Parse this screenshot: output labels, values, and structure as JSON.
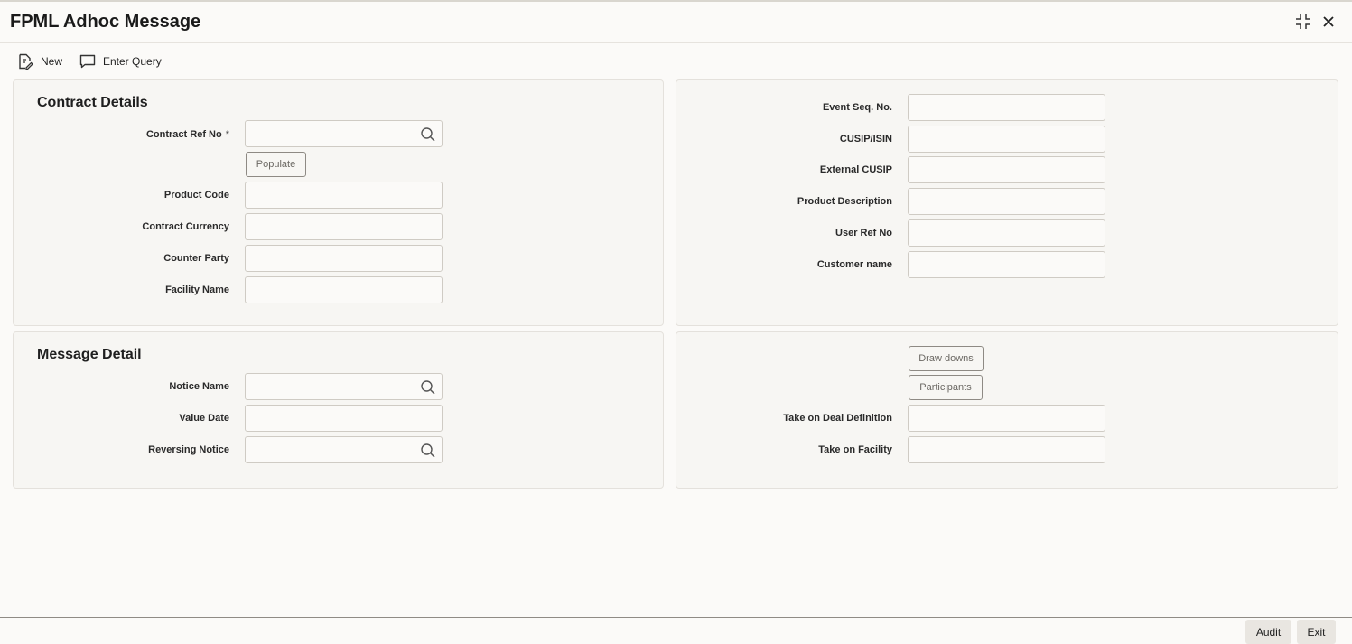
{
  "window": {
    "title": "FPML Adhoc Message",
    "controls": {
      "minimize_icon": "collapse-arrows-icon",
      "close_icon": "close-icon"
    }
  },
  "toolbar": {
    "new_label": "New",
    "new_icon": "new-document-icon",
    "enter_query_label": "Enter Query",
    "enter_query_icon": "speech-bubble-icon"
  },
  "contract_details": {
    "title": "Contract Details",
    "contract_ref_no": {
      "label": "Contract Ref No",
      "required_mark": "*",
      "value": ""
    },
    "populate_label": "Populate",
    "product_code": {
      "label": "Product Code",
      "value": ""
    },
    "contract_currency": {
      "label": "Contract Currency",
      "value": ""
    },
    "counter_party": {
      "label": "Counter Party",
      "value": ""
    },
    "facility_name": {
      "label": "Facility Name",
      "value": ""
    }
  },
  "contract_right": {
    "event_seq_no": {
      "label": "Event Seq. No.",
      "value": ""
    },
    "cusip_isin": {
      "label": "CUSIP/ISIN",
      "value": ""
    },
    "external_cusip": {
      "label": "External CUSIP",
      "value": ""
    },
    "product_description": {
      "label": "Product Description",
      "value": ""
    },
    "user_ref_no": {
      "label": "User Ref No",
      "value": ""
    },
    "customer_name": {
      "label": "Customer name",
      "value": ""
    }
  },
  "message_detail": {
    "title": "Message Detail",
    "notice_name": {
      "label": "Notice Name",
      "value": ""
    },
    "value_date": {
      "label": "Value Date",
      "value": ""
    },
    "reversing_notice": {
      "label": "Reversing Notice",
      "value": ""
    }
  },
  "message_right": {
    "draw_downs_label": "Draw downs",
    "participants_label": "Participants",
    "take_on_deal_definition": {
      "label": "Take on Deal Definition",
      "value": ""
    },
    "take_on_facility": {
      "label": "Take on Facility",
      "value": ""
    }
  },
  "footer": {
    "audit_label": "Audit",
    "exit_label": "Exit"
  }
}
